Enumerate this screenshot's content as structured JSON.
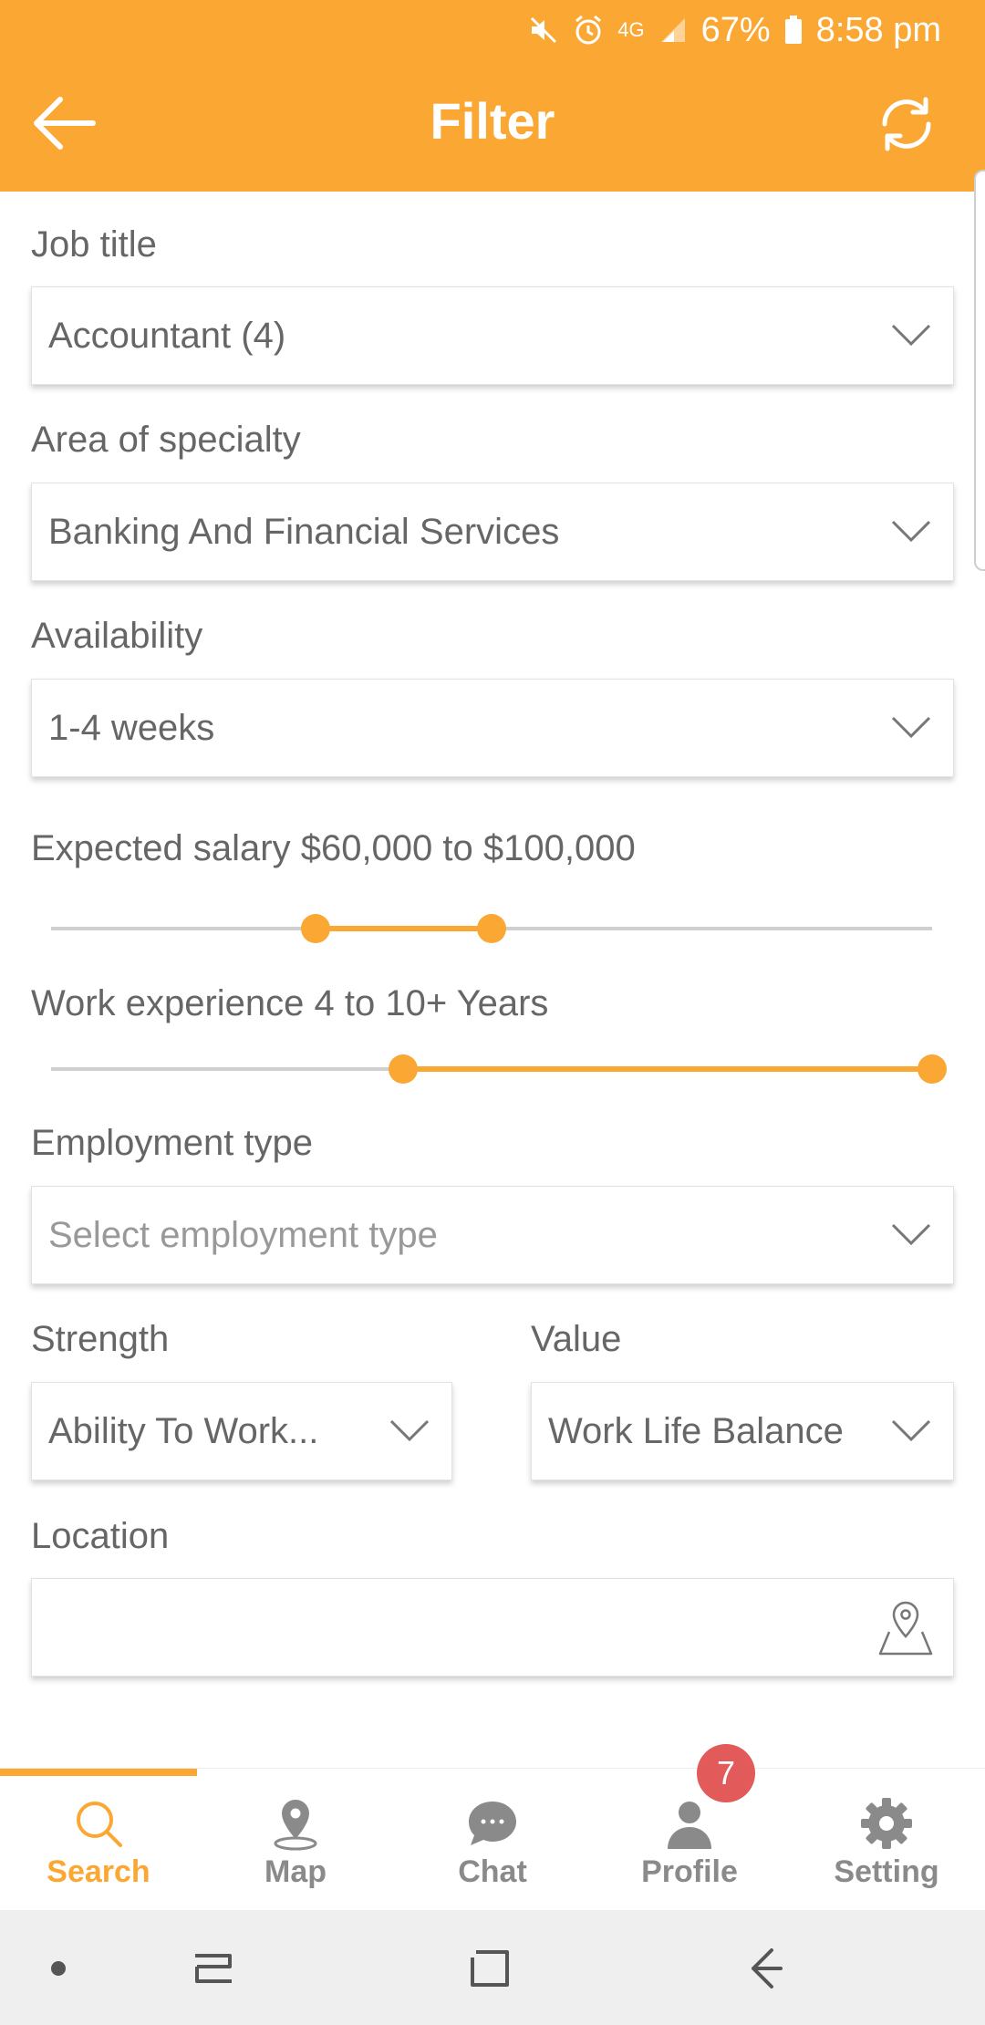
{
  "status_bar": {
    "network": "4G",
    "battery": "67%",
    "time": "8:58 pm"
  },
  "header": {
    "title": "Filter",
    "back_icon": "arrow-left-icon",
    "refresh_icon": "refresh-icon"
  },
  "form": {
    "job_title": {
      "label": "Job title",
      "value": "Accountant (4)"
    },
    "area_of_specialty": {
      "label": "Area of specialty",
      "value": "Banking And Financial Services"
    },
    "availability": {
      "label": "Availability",
      "value": "1-4 weeks"
    },
    "expected_salary": {
      "label": "Expected salary $60,000 to $100,000",
      "low_fraction": 0.3,
      "high_fraction": 0.5
    },
    "work_experience": {
      "label": "Work experience 4 to 10+ Years",
      "low_fraction": 0.4,
      "high_fraction": 1.0
    },
    "employment_type": {
      "label": "Employment type",
      "placeholder": "Select employment type"
    },
    "strength": {
      "label": "Strength",
      "value": "Ability To Work..."
    },
    "value": {
      "label": "Value",
      "value": "Work Life Balance"
    },
    "location": {
      "label": "Location",
      "value": ""
    }
  },
  "bottom_nav": {
    "items": [
      {
        "label": "Search",
        "icon": "search-icon",
        "active": true
      },
      {
        "label": "Map",
        "icon": "map-pin-icon",
        "active": false
      },
      {
        "label": "Chat",
        "icon": "chat-bubble-icon",
        "active": false
      },
      {
        "label": "Profile",
        "icon": "person-icon",
        "active": false
      },
      {
        "label": "Setting",
        "icon": "gear-icon",
        "active": false
      }
    ],
    "profile_badge": "7"
  },
  "colors": {
    "accent": "#FBA733",
    "badge": "#E25A5A",
    "text": "#666666"
  }
}
